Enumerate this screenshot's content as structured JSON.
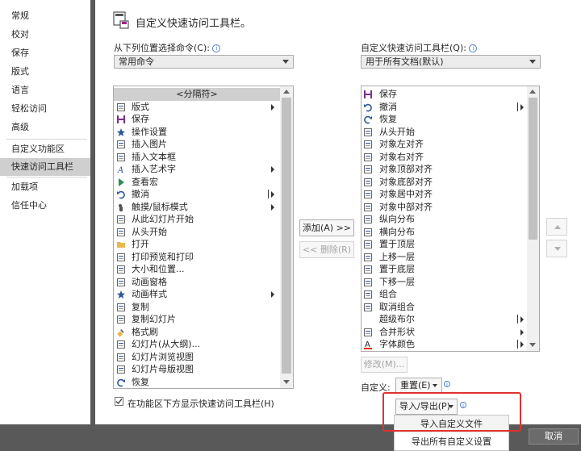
{
  "sidebar": {
    "items": [
      {
        "label": "常规"
      },
      {
        "label": "校对"
      },
      {
        "label": "保存"
      },
      {
        "label": "版式"
      },
      {
        "label": "语言"
      },
      {
        "label": "轻松访问"
      },
      {
        "label": "高级"
      },
      {
        "label": "自定义功能区"
      },
      {
        "label": "快速访问工具栏",
        "selected": true
      },
      {
        "label": "加载项"
      },
      {
        "label": "信任中心"
      }
    ]
  },
  "header": {
    "title": "自定义快速访问工具栏。"
  },
  "left_panel": {
    "label": "从下列位置选择命令(C):",
    "dropdown_value": "常用命令",
    "items": [
      {
        "label": "<分隔符>",
        "icon": "none",
        "highlighted": true
      },
      {
        "label": "版式",
        "icon": "layout-icon",
        "sub": "arrow"
      },
      {
        "label": "保存",
        "icon": "save-icon"
      },
      {
        "label": "操作设置",
        "icon": "star-icon"
      },
      {
        "label": "插入图片",
        "icon": "picture-icon"
      },
      {
        "label": "插入文本框",
        "icon": "textbox-icon"
      },
      {
        "label": "插入艺术字",
        "icon": "wordart-icon",
        "sub": "arrow"
      },
      {
        "label": "查看宏",
        "icon": "play-icon"
      },
      {
        "label": "撤消",
        "icon": "undo-icon",
        "sub": "bar"
      },
      {
        "label": "触摸/鼠标模式",
        "icon": "touch-icon",
        "sub": "arrow"
      },
      {
        "label": "从此幻灯片开始",
        "icon": "slide-start-icon"
      },
      {
        "label": "从头开始",
        "icon": "slide-begin-icon"
      },
      {
        "label": "打开",
        "icon": "folder-icon"
      },
      {
        "label": "打印预览和打印",
        "icon": "print-preview-icon"
      },
      {
        "label": "大小和位置...",
        "icon": "size-icon"
      },
      {
        "label": "动画窗格",
        "icon": "animation-pane-icon"
      },
      {
        "label": "动画样式",
        "icon": "star-icon",
        "sub": "arrow"
      },
      {
        "label": "复制",
        "icon": "copy-icon"
      },
      {
        "label": "复制幻灯片",
        "icon": "duplicate-icon"
      },
      {
        "label": "格式刷",
        "icon": "brush-icon"
      },
      {
        "label": "幻灯片(从大纲)...",
        "icon": "slide-icon"
      },
      {
        "label": "幻灯片浏览视图",
        "icon": "sorter-icon"
      },
      {
        "label": "幻灯片母版视图",
        "icon": "master-icon"
      },
      {
        "label": "恢复",
        "icon": "redo-icon"
      }
    ],
    "show_below_checkbox": "在功能区下方显示快速访问工具栏(H)"
  },
  "middle": {
    "add_button": "添加(A) >>",
    "remove_button": "<< 删除(R)"
  },
  "right_panel": {
    "label": "自定义快速访问工具栏(Q):",
    "dropdown_value": "用于所有文档(默认)",
    "items": [
      {
        "label": "保存",
        "icon": "save-icon"
      },
      {
        "label": "撤消",
        "icon": "undo-icon",
        "sub": "bar"
      },
      {
        "label": "恢复",
        "icon": "redo-icon"
      },
      {
        "label": "从头开始",
        "icon": "slide-begin-icon"
      },
      {
        "label": "对象左对齐",
        "icon": "align-left-icon"
      },
      {
        "label": "对象右对齐",
        "icon": "align-right-icon"
      },
      {
        "label": "对象顶部对齐",
        "icon": "align-top-icon"
      },
      {
        "label": "对象底部对齐",
        "icon": "align-bottom-icon"
      },
      {
        "label": "对象居中对齐",
        "icon": "align-center-icon"
      },
      {
        "label": "对象中部对齐",
        "icon": "align-middle-icon"
      },
      {
        "label": "纵向分布",
        "icon": "distribute-v-icon"
      },
      {
        "label": "横向分布",
        "icon": "distribute-h-icon"
      },
      {
        "label": "置于顶层",
        "icon": "bring-front-icon"
      },
      {
        "label": "上移一层",
        "icon": "bring-forward-icon"
      },
      {
        "label": "置于底层",
        "icon": "send-back-icon"
      },
      {
        "label": "下移一层",
        "icon": "send-backward-icon"
      },
      {
        "label": "组合",
        "icon": "group-icon"
      },
      {
        "label": "取消组合",
        "icon": "ungroup-icon"
      },
      {
        "label": "超级布尔",
        "icon": "none",
        "sub": "bar"
      },
      {
        "label": "合并形状",
        "icon": "merge-shapes-icon",
        "sub": "arrow"
      },
      {
        "label": "字体颜色",
        "icon": "font-color-icon",
        "sub": "bar"
      }
    ],
    "modify_button": "修改(M)...",
    "customize_label": "自定义:",
    "reset_button": "重置(E)",
    "import_export_button": "导入/导出(P)"
  },
  "dropdown_menu": {
    "items": [
      {
        "label": "导入自定义文件"
      },
      {
        "label": "导出所有自定义设置"
      }
    ]
  },
  "footer": {
    "cancel_button": "取消"
  },
  "colors": {
    "accent": "#2b579a",
    "highlight_box": "#e03131",
    "selected": "#cfcfcf"
  }
}
